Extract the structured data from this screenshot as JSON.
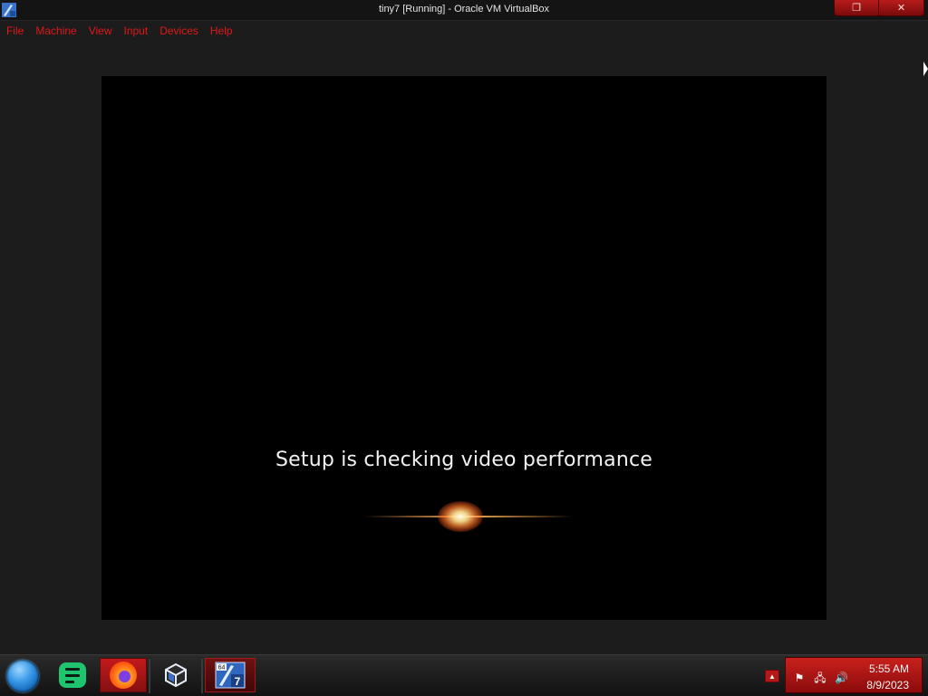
{
  "window": {
    "title": "tiny7 [Running] - Oracle VM VirtualBox",
    "restore_glyph": "❐",
    "close_glyph": "✕"
  },
  "menubar": {
    "items": [
      "File",
      "Machine",
      "View",
      "Input",
      "Devices",
      "Help"
    ],
    "color": "#e01818"
  },
  "vm_screen": {
    "message": "Setup is checking video performance"
  },
  "taskbar": {
    "start_icon": "windows-orb-icon",
    "pinned": [
      {
        "name": "notes-app",
        "icon": "notes-icon"
      },
      {
        "name": "firefox",
        "icon": "firefox-icon"
      },
      {
        "name": "virtualbox",
        "icon": "virtualbox-icon"
      },
      {
        "name": "tiny7",
        "icon": "windows7-64-icon",
        "badge_top": "64",
        "badge_bottom": "7"
      }
    ],
    "accent": "#c41a1a"
  },
  "tray": {
    "show_hidden_glyph": "▲",
    "icons": [
      "action-center-flag-icon",
      "network-icon",
      "volume-icon"
    ],
    "flag_glyph": "⚑",
    "network_glyph": "🖧",
    "volume_glyph": "🔊",
    "time": "5:55 AM",
    "date": "8/9/2023"
  }
}
